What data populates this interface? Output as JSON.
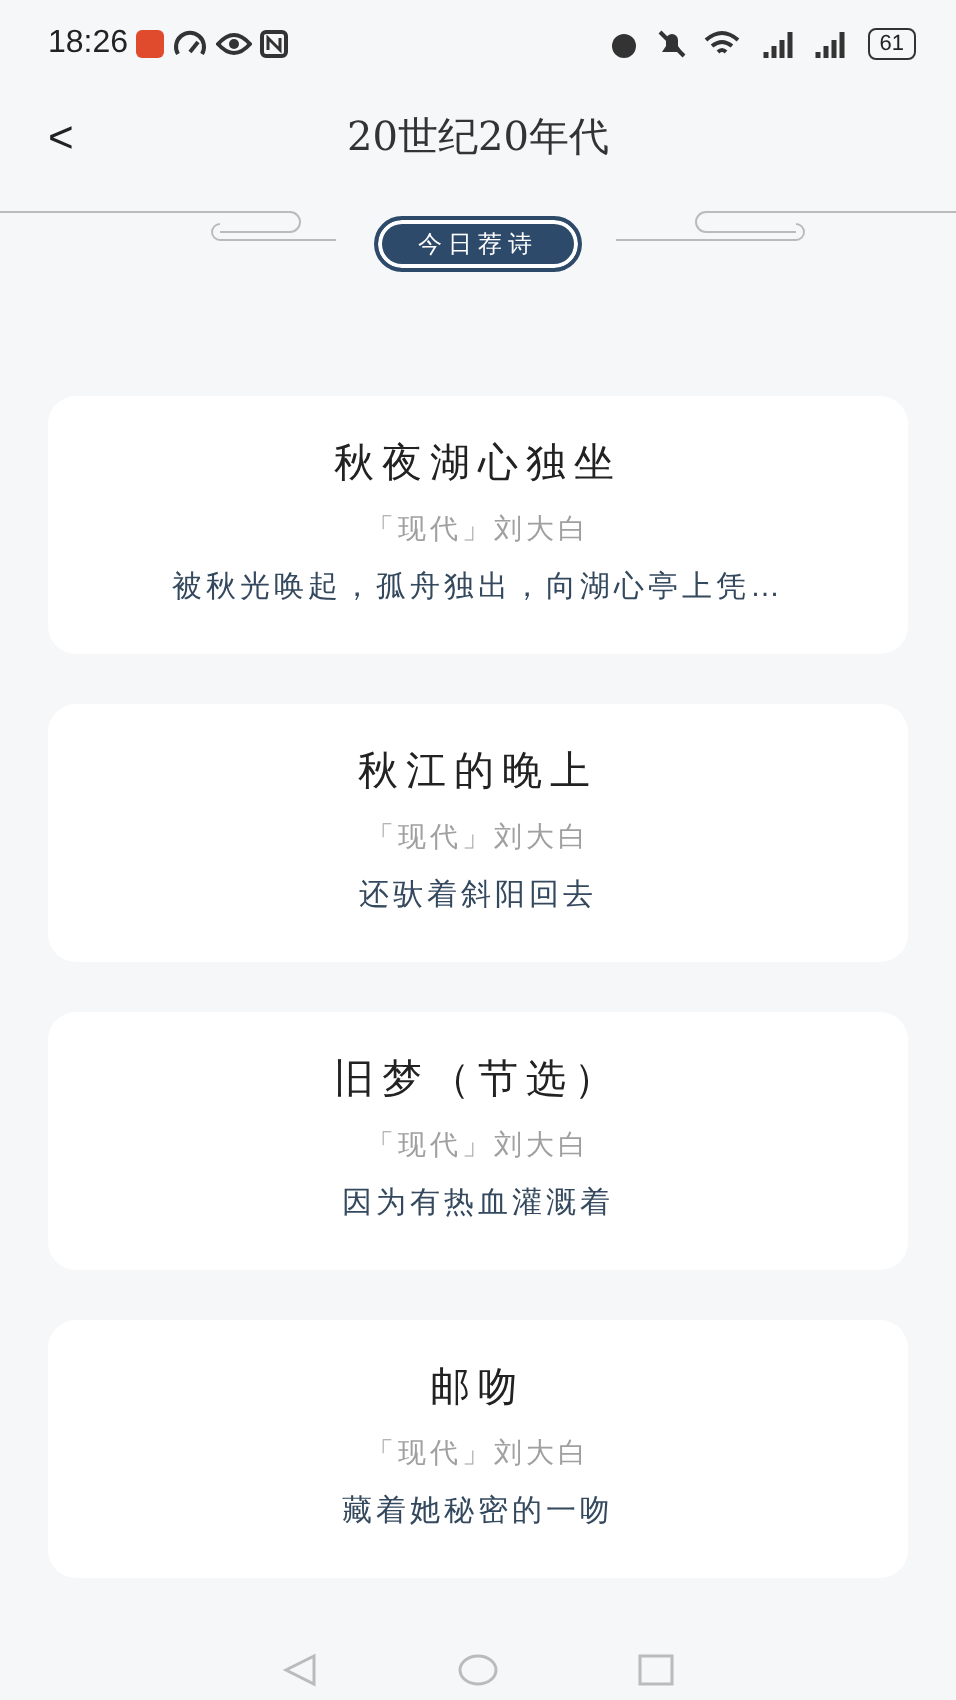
{
  "status_bar": {
    "time": "18:26",
    "battery": "61"
  },
  "header": {
    "back": "<",
    "title": "20世纪20年代"
  },
  "section_badge": "今日荐诗",
  "poems": [
    {
      "title": "秋夜湖心独坐",
      "meta": "「现代」刘大白",
      "excerpt": "被秋光唤起，孤舟独出，向湖心亭上凭…"
    },
    {
      "title": "秋江的晚上",
      "meta": "「现代」刘大白",
      "excerpt": "还驮着斜阳回去"
    },
    {
      "title": "旧梦（节选）",
      "meta": "「现代」刘大白",
      "excerpt": "因为有热血灌溉着"
    },
    {
      "title": "邮吻",
      "meta": "「现代」刘大白",
      "excerpt": "藏着她秘密的一吻"
    }
  ]
}
